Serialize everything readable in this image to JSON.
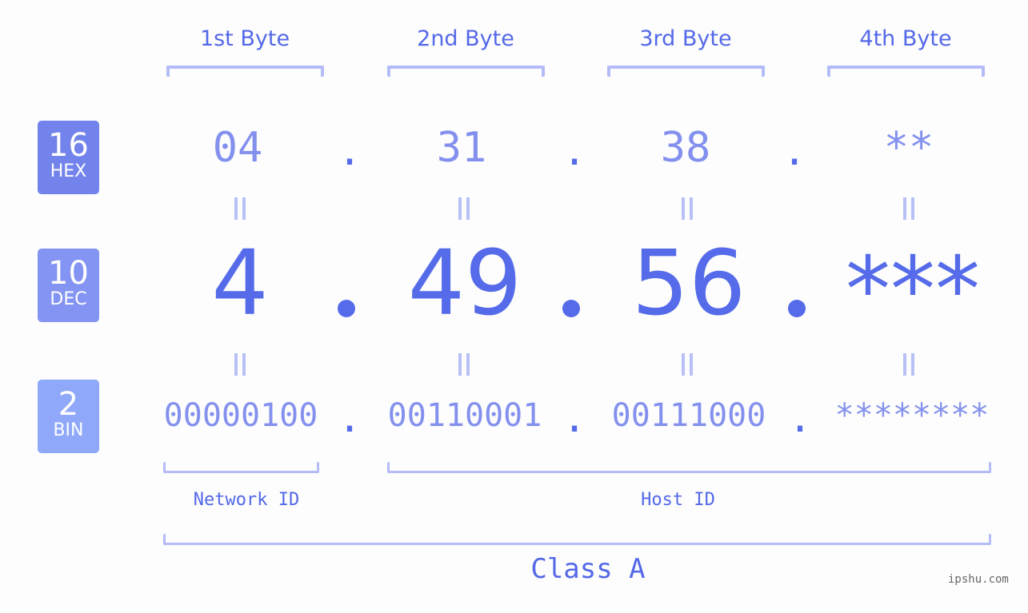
{
  "byte_headers": [
    "1st Byte",
    "2nd Byte",
    "3rd Byte",
    "4th Byte"
  ],
  "badges": {
    "hex": {
      "num": "16",
      "label": "HEX",
      "color": "#7383ec"
    },
    "dec": {
      "num": "10",
      "label": "DEC",
      "color": "#8494f2"
    },
    "bin": {
      "num": "2",
      "label": "BIN",
      "color": "#8fa8f9"
    }
  },
  "hex_values": [
    "04",
    "31",
    "38",
    "**"
  ],
  "dec_values": [
    "4",
    "49",
    "56",
    "***"
  ],
  "bin_values": [
    "00000100",
    "00110001",
    "00111000",
    "********"
  ],
  "separator": ".",
  "network_id_label": "Network ID",
  "host_id_label": "Host ID",
  "class_label": "Class A",
  "watermark": "ipshu.com",
  "colors": {
    "accent": "#5468e8",
    "light_value": "#8390ee",
    "bracket": "#b3bcf7",
    "background": "#fcfdfc"
  }
}
